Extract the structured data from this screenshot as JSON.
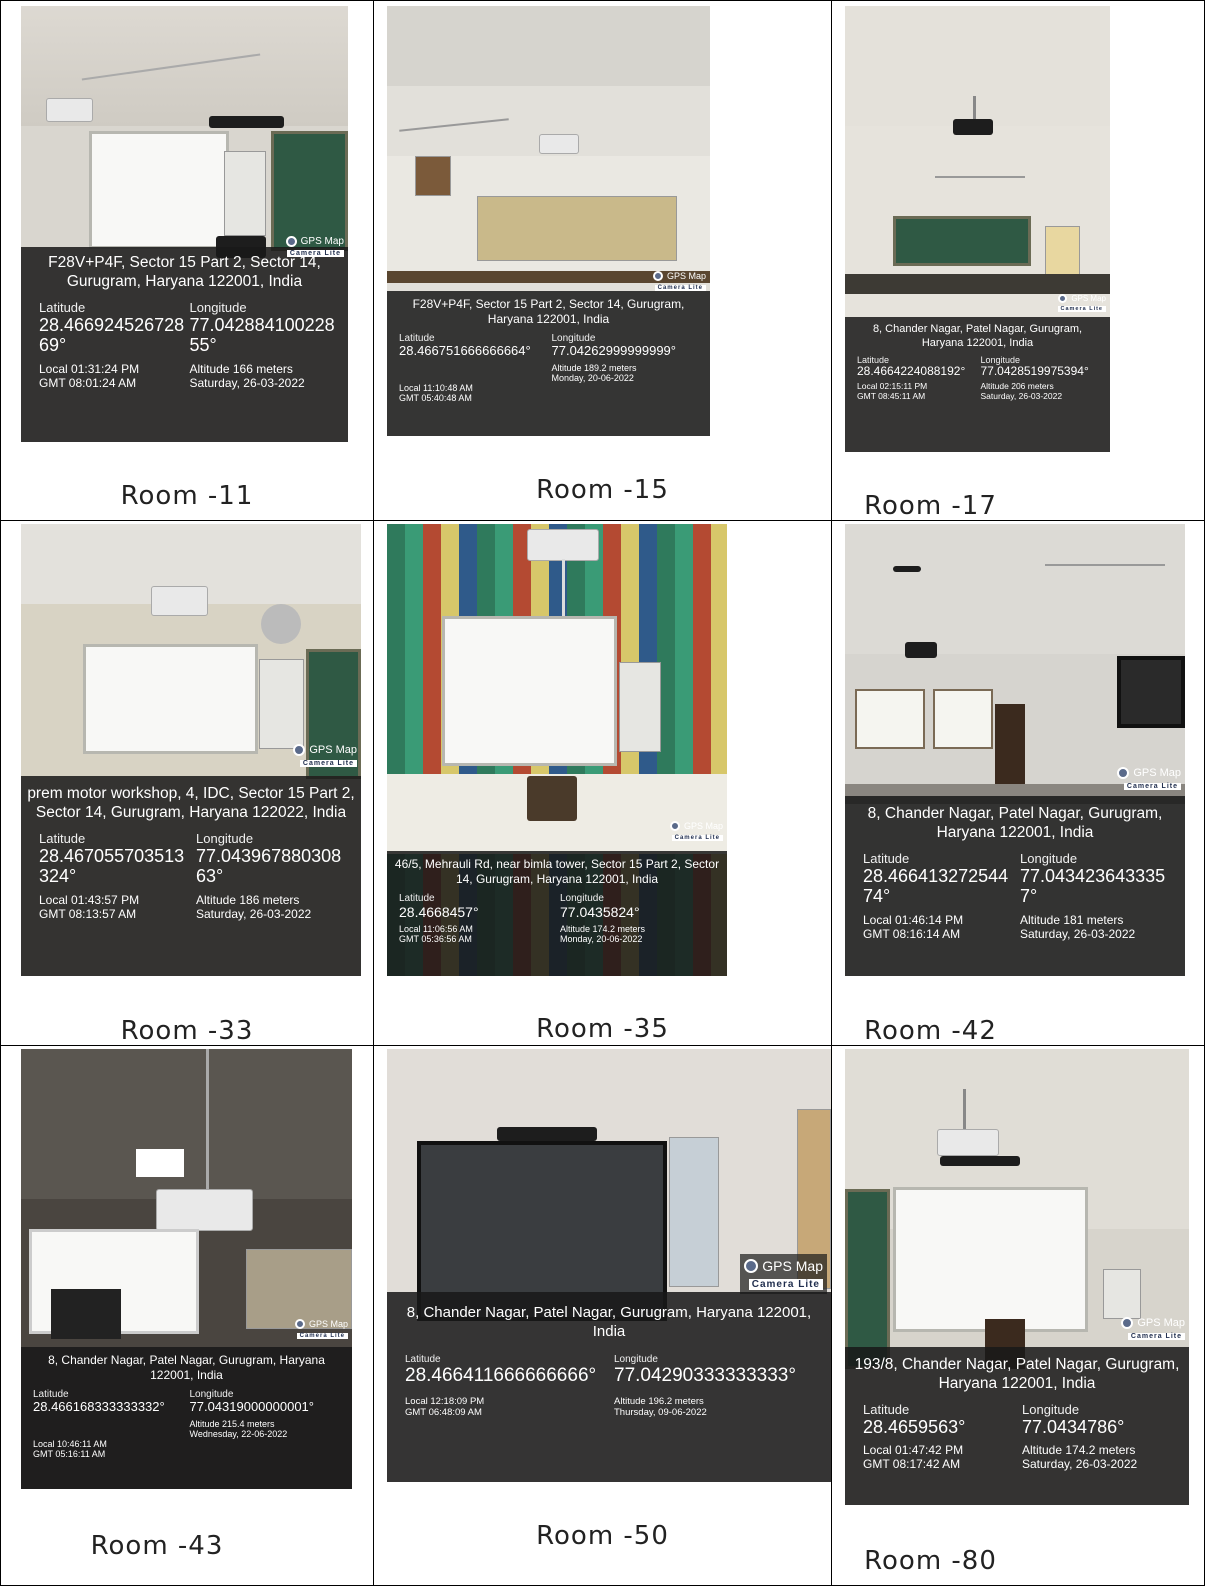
{
  "cells": [
    {
      "room": "Room -11",
      "address": "F28V+P4F, Sector 15 Part 2, Sector 14, Gurugram, Haryana 122001, India",
      "lat_label": "Latitude",
      "lat": "28.46692452672869°",
      "lon_label": "Longitude",
      "lon": "77.04288410022855°",
      "local": "Local 01:31:24 PM",
      "gmt": "GMT 08:01:24 AM",
      "altitude": "Altitude 166 meters",
      "date": "Saturday, 26-03-2022",
      "badge_title": "GPS Map",
      "badge_sub": "Camera Lite"
    },
    {
      "room": "Room -15",
      "address": "F28V+P4F, Sector 15 Part 2, Sector 14, Gurugram, Haryana 122001, India",
      "lat_label": "Latitude",
      "lat": "28.466751666666664°",
      "lon_label": "Longitude",
      "lon": "77.04262999999999°",
      "local": "Local 11:10:48 AM",
      "gmt": "GMT 05:40:48 AM",
      "altitude": "Altitude 189.2 meters",
      "date": "Monday, 20-06-2022",
      "badge_title": "GPS Map",
      "badge_sub": "Camera Lite"
    },
    {
      "room": "Room -17",
      "address": "8, Chander Nagar, Patel Nagar, Gurugram, Haryana 122001, India",
      "lat_label": "Latitude",
      "lat": "28.4664224088192°",
      "lon_label": "Longitude",
      "lon": "77.0428519975394°",
      "local": "Local 02:15:11 PM",
      "gmt": "GMT 08:45:11 AM",
      "altitude": "Altitude 206 meters",
      "date": "Saturday, 26-03-2022",
      "badge_title": "GPS Map",
      "badge_sub": "Camera Lite"
    },
    {
      "room": "Room -33",
      "address": "prem motor workshop, 4, IDC, Sector 15 Part 2, Sector 14, Gurugram, Haryana 122022, India",
      "lat_label": "Latitude",
      "lat": "28.467055703513324°",
      "lon_label": "Longitude",
      "lon": "77.04396788030863°",
      "local": "Local 01:43:57 PM",
      "gmt": "GMT 08:13:57 AM",
      "altitude": "Altitude 186 meters",
      "date": "Saturday, 26-03-2022",
      "badge_title": "GPS Map",
      "badge_sub": "Camera Lite"
    },
    {
      "room": "Room -35",
      "address": "46/5, Mehrauli Rd, near bimla tower, Sector 15 Part 2, Sector 14, Gurugram, Haryana 122001, India",
      "lat_label": "Latitude",
      "lat": "28.4668457°",
      "lon_label": "Longitude",
      "lon": "77.0435824°",
      "local": "Local 11:06:56 AM",
      "gmt": "GMT 05:36:56 AM",
      "altitude": "Altitude 174.2 meters",
      "date": "Monday, 20-06-2022",
      "badge_title": "GPS Map",
      "badge_sub": "Camera Lite"
    },
    {
      "room": "Room -42",
      "address": "8, Chander Nagar, Patel Nagar, Gurugram, Haryana 122001, India",
      "lat_label": "Latitude",
      "lat": "28.46641327254474°",
      "lon_label": "Longitude",
      "lon": "77.0434236433357°",
      "local": "Local 01:46:14 PM",
      "gmt": "GMT 08:16:14 AM",
      "altitude": "Altitude 181 meters",
      "date": "Saturday, 26-03-2022",
      "badge_title": "GPS Map",
      "badge_sub": "Camera Lite"
    },
    {
      "room": "Room -43",
      "address": "8, Chander Nagar, Patel Nagar, Gurugram, Haryana 122001, India",
      "lat_label": "Latitude",
      "lat": "28.466168333333332°",
      "lon_label": "Longitude",
      "lon": "77.04319000000001°",
      "local": "Local 10:46:11 AM",
      "gmt": "GMT 05:16:11 AM",
      "altitude": "Altitude 215.4 meters",
      "date": "Wednesday, 22-06-2022",
      "badge_title": "GPS Map",
      "badge_sub": "Camera Lite"
    },
    {
      "room": "Room -50",
      "address": "8, Chander Nagar, Patel Nagar, Gurugram, Haryana 122001, India",
      "lat_label": "Latitude",
      "lat": "28.466411666666666°",
      "lon_label": "Longitude",
      "lon": "77.04290333333333°",
      "local": "Local 12:18:09 PM",
      "gmt": "GMT 06:48:09 AM",
      "altitude": "Altitude 196.2 meters",
      "date": "Thursday, 09-06-2022",
      "badge_title": "GPS Map",
      "badge_sub": "Camera Lite"
    },
    {
      "room": "Room -80",
      "address": "193/8, Chander Nagar, Patel Nagar, Gurugram, Haryana 122001, India",
      "lat_label": "Latitude",
      "lat": "28.4659563°",
      "lon_label": "Longitude",
      "lon": "77.0434786°",
      "local": "Local 01:47:42 PM",
      "gmt": "GMT 08:17:42 AM",
      "altitude": "Altitude 174.2 meters",
      "date": "Saturday, 26-03-2022",
      "badge_title": "GPS Map",
      "badge_sub": "Camera Lite"
    }
  ]
}
